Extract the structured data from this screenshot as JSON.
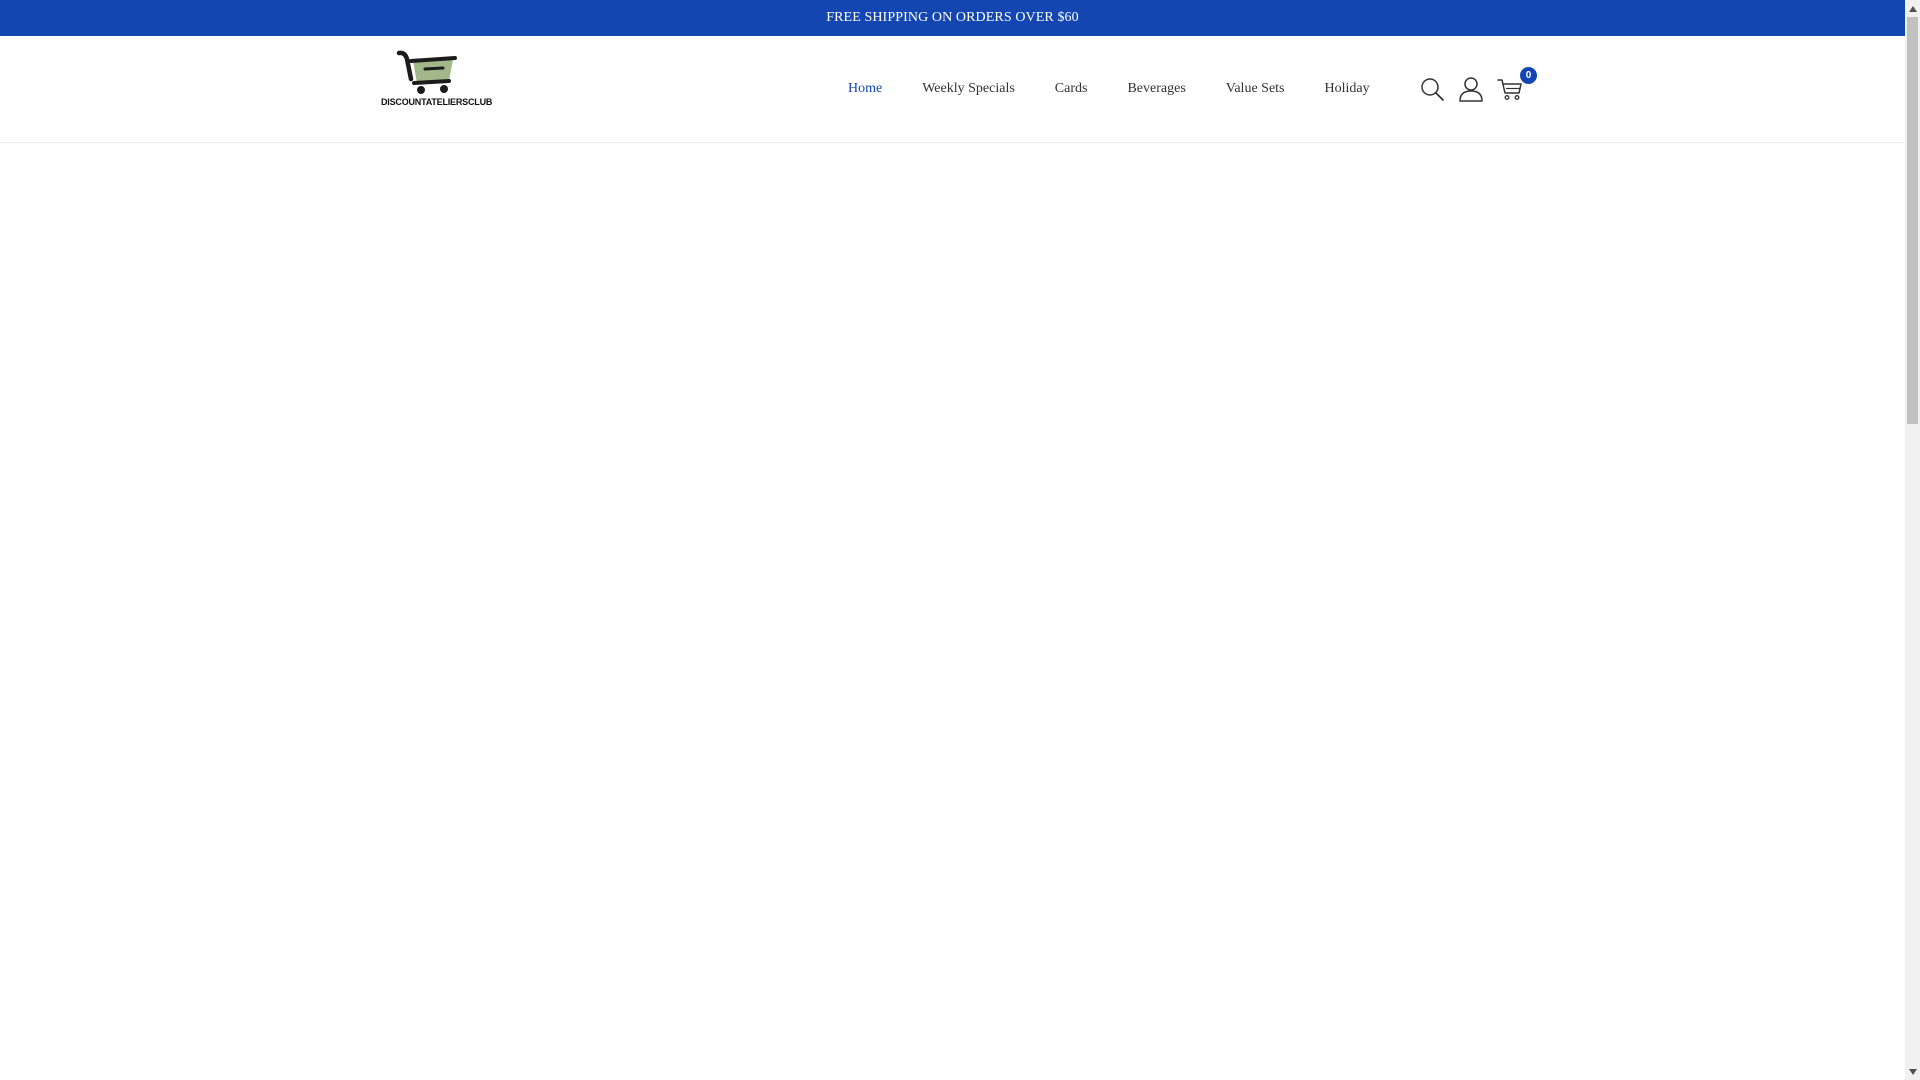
{
  "announcement": {
    "text": "FREE SHIPPING ON ORDERS OVER $60"
  },
  "logo": {
    "text": "DISCOUNTATELIERSCLUB",
    "icon": "shopping-cart-logo-icon",
    "accent_color": "#a3b88a",
    "dark_color": "#1b1b1b"
  },
  "nav": {
    "items": [
      {
        "label": "Home",
        "active": true
      },
      {
        "label": "Weekly Specials",
        "active": false
      },
      {
        "label": "Cards",
        "active": false
      },
      {
        "label": "Beverages",
        "active": false
      },
      {
        "label": "Value Sets",
        "active": false
      },
      {
        "label": "Holiday",
        "active": false
      }
    ]
  },
  "header_icons": {
    "search": "search-icon",
    "account": "user-icon",
    "cart": "cart-icon",
    "cart_count": "0"
  },
  "colors": {
    "brand": "#1446b1",
    "text": "#333333",
    "background": "#ffffff"
  }
}
